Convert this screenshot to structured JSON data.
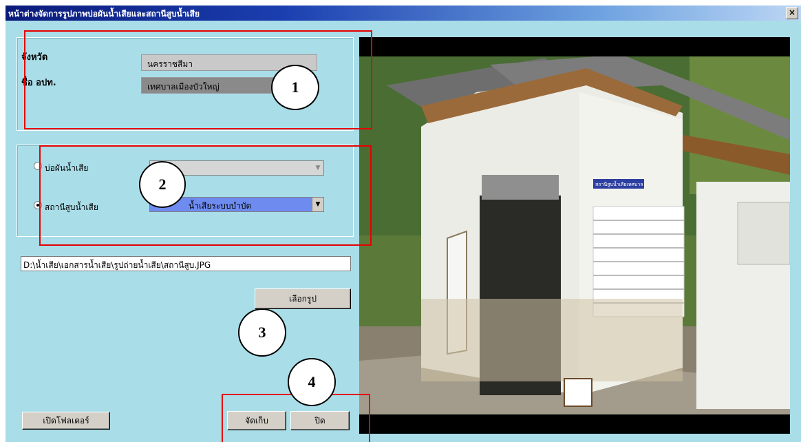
{
  "window": {
    "title": "หน้าต่างจัดการรูปภาพบ่อผันน้ำเสียและสถานีสูบน้ำเสีย",
    "close_label": "×"
  },
  "location": {
    "province_label": "จังหวัด",
    "province_value": "นครราชสีมา",
    "org_label": "ชื่อ อปท.",
    "org_value": "เทศบาลเมืองบัวใหญ่"
  },
  "type_selector": {
    "option_diversion_label": "บ่อผันน้ำเสีย",
    "option_diversion_value": "",
    "option_pump_label": "สถานีสูบน้ำเสีย",
    "option_pump_value": "น้ำเสียระบบบำบัด",
    "selected": "pump"
  },
  "file_path": "D:\\น้ำเสีย\\เอกสารน้ำเสีย\\รูปถ่ายน้ำเสีย\\สถานีสูบ.JPG",
  "buttons": {
    "choose_image": "เลือกรูป",
    "open_folder": "เปิดโฟลเดอร์",
    "save": "จัดเก็บ",
    "close": "ปิด"
  },
  "photo_sign_text": "สถานีสูบน้ำเสียเทศบาล",
  "annotations": [
    "1",
    "2",
    "3",
    "4"
  ],
  "colors": {
    "form_bg": "#a9dde8",
    "annotation_red": "#e60000",
    "selected_combo": "#6e8cf0"
  }
}
